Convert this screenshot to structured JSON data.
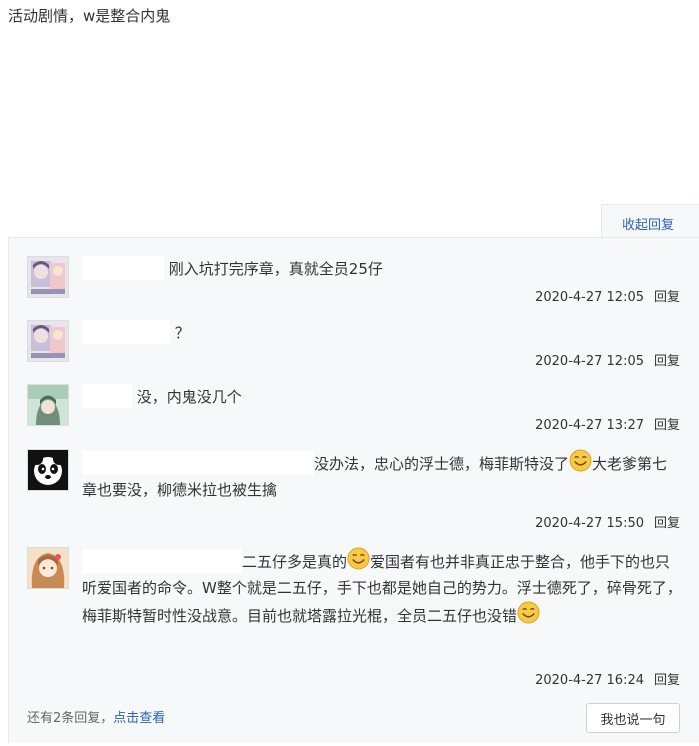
{
  "post": {
    "text": "活动剧情，w是整合内鬼"
  },
  "collapse_label": "收起回复",
  "replies": [
    {
      "text": "刚入坑打完序章，真就全员25仔",
      "time": "2020-4-27 12:05",
      "reply_label": "回复",
      "avatar": "anime-girl-avatar"
    },
    {
      "text": "？",
      "time": "2020-4-27 12:05",
      "reply_label": "回复",
      "avatar": "anime-girl-avatar"
    },
    {
      "text": "没，内鬼没几个",
      "time": "2020-4-27 13:27",
      "reply_label": "回复",
      "avatar": "green-anime-avatar"
    },
    {
      "part1": "没办法，忠心的浮士德，梅菲斯特没了",
      "part2": "大老爹第七章也要没，柳德米拉也被生擒",
      "time": "2020-4-27 15:50",
      "reply_label": "回复",
      "avatar": "panda-avatar",
      "emoji": "smile-emoji"
    },
    {
      "part1": "二五仔多是真的",
      "part2": "爱国者有也并非真正忠于整合，他手下的也只听爱国者的命令。W整个就是二五仔，手下也都是她自己的势力。浮士德死了，碎骨死了，梅菲斯特暂时性没战意。目前也就塔露拉光棍，全员二五仔也没错",
      "time": "2020-4-27 16:24",
      "reply_label": "回复",
      "avatar": "brown-hair-anime-avatar",
      "emoji": "smile-emoji"
    }
  ],
  "footer": {
    "more_prefix": "还有2条回复，",
    "more_link": "点击查看",
    "say_button": "我也说一句"
  }
}
